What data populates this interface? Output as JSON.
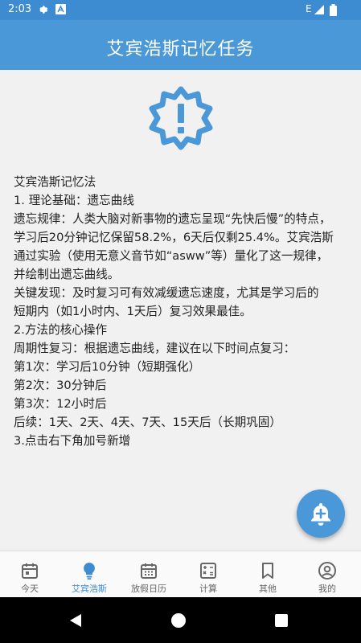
{
  "status_bar": {
    "time": "2:03",
    "network": "E"
  },
  "app_bar": {
    "title": "艾宾浩斯记忆任务"
  },
  "badge_icon": "alert-badge-icon",
  "content_lines": [
    "艾宾浩斯记忆法",
    "1. 理论基础：遗忘曲线",
    "遗忘规律：人类大脑对新事物的遗忘呈现“先快后慢”的特点，",
    "学习后20分钟记忆保留58.2%，6天后仅剩25.4%。艾宾浩斯",
    "通过实验（使用无意义音节如“asww”等）量化了这一规律，",
    "并绘制出遗忘曲线。",
    "关键发现：及时复习可有效减缓遗忘速度，尤其是学习后的",
    "短期内（如1小时内、1天后）复习效果最佳。",
    "2.方法的核心操作",
    "周期性复习：根据遗忘曲线，建议在以下时间点复习：",
    "第1次：学习后10分钟（短期强化）",
    "第2次：30分钟后",
    "第3次：12小时后",
    "后续：1天、2天、4天、7天、15天后（长期巩固）",
    "3.点击右下角加号新增"
  ],
  "fab": {
    "icon": "bell-plus-icon"
  },
  "bottom_nav": [
    {
      "label": "今天",
      "icon": "calendar-icon"
    },
    {
      "label": "艾宾浩斯",
      "icon": "lightbulb-icon",
      "active": true
    },
    {
      "label": "放假日历",
      "icon": "calendar-grid-icon"
    },
    {
      "label": "计算",
      "icon": "calculator-icon"
    },
    {
      "label": "其他",
      "icon": "bookmark-icon"
    },
    {
      "label": "我的",
      "icon": "account-icon"
    }
  ],
  "colors": {
    "primary": "#4a98d8",
    "status_bar": "#3d8bd0",
    "active_nav": "#3d8bd0",
    "inactive_nav": "#666666"
  }
}
